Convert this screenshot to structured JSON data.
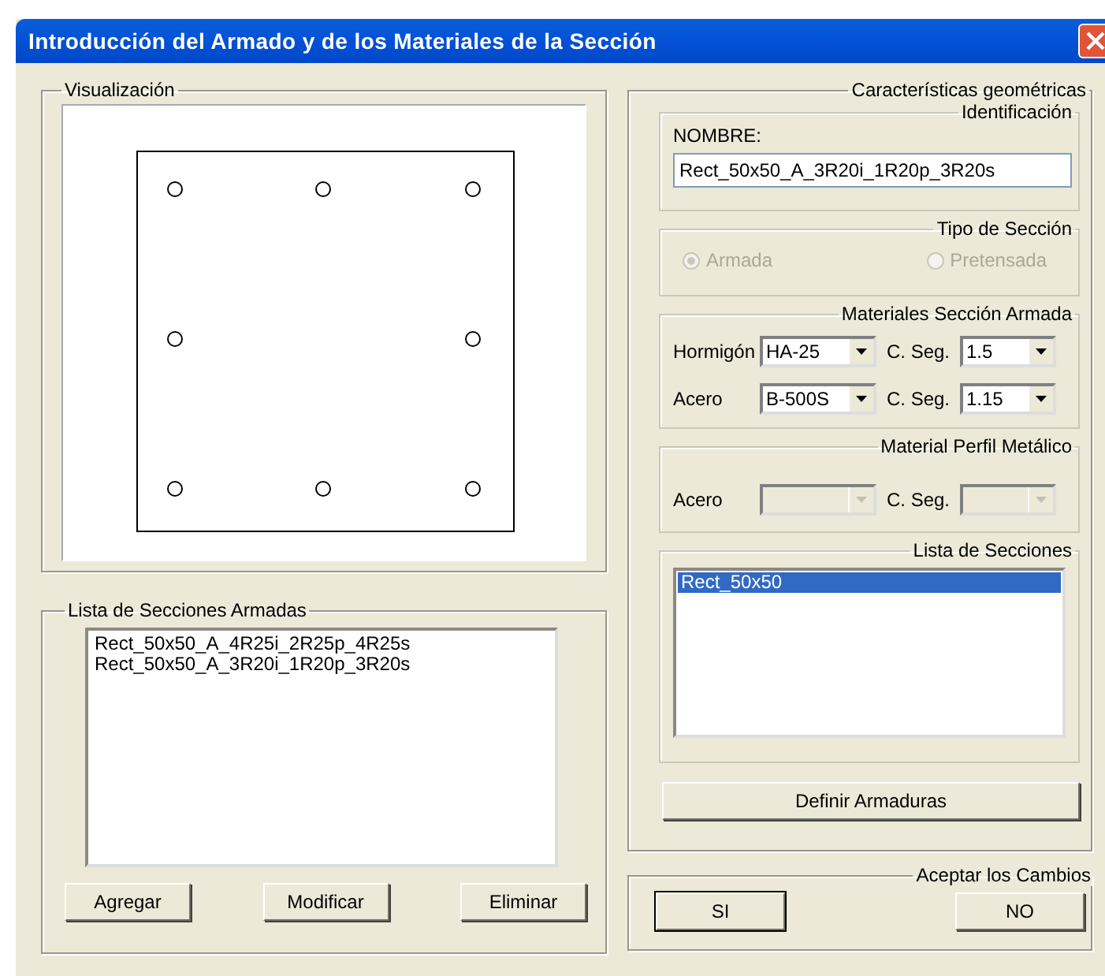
{
  "window": {
    "title": "Introducción del Armado y de los Materiales de la Sección"
  },
  "visualization": {
    "label": "Visualización"
  },
  "armed_sections": {
    "label": "Lista de Secciones Armadas",
    "items": [
      {
        "text": "Rect_50x50_A_4R25i_2R25p_4R25s",
        "selected": false
      },
      {
        "text": "Rect_50x50_A_3R20i_1R20p_3R20s",
        "selected": false
      }
    ],
    "buttons": [
      "Agregar",
      "Modificar",
      "Eliminar"
    ]
  },
  "geometry": {
    "label": "Características geométricas",
    "identification": {
      "label": "Identificación",
      "field_label": "NOMBRE:",
      "value": "Rect_50x50_A_3R20i_1R20p_3R20s"
    },
    "section_type": {
      "label": "Tipo de Sección",
      "disabled": true,
      "options": [
        {
          "label": "Armada",
          "selected": true
        },
        {
          "label": "Pretensada",
          "selected": false
        }
      ]
    },
    "materials": {
      "label": "Materiales Sección Armada",
      "disabled": false,
      "rows": [
        {
          "label": "Hormigón",
          "value": "HA-25",
          "safety_label": "C. Seg.",
          "safety_value": "1.5"
        },
        {
          "label": "Acero",
          "value": "B-500S",
          "safety_label": "C. Seg.",
          "safety_value": "1.15"
        }
      ]
    },
    "steel_profile": {
      "label": "Material Perfil Metálico",
      "disabled": true,
      "rows": [
        {
          "label": "Acero",
          "safety_label": "C. Seg."
        }
      ]
    },
    "sections": {
      "label": "Lista de Secciones",
      "items": [
        {
          "text": "Rect_50x50",
          "selected": true
        }
      ]
    },
    "define_button": "Definir Armaduras"
  },
  "accept": {
    "label": "Aceptar los Cambios",
    "buttons": [
      {
        "label": "SI",
        "default": true
      },
      {
        "label": "NO",
        "default": false
      }
    ]
  }
}
